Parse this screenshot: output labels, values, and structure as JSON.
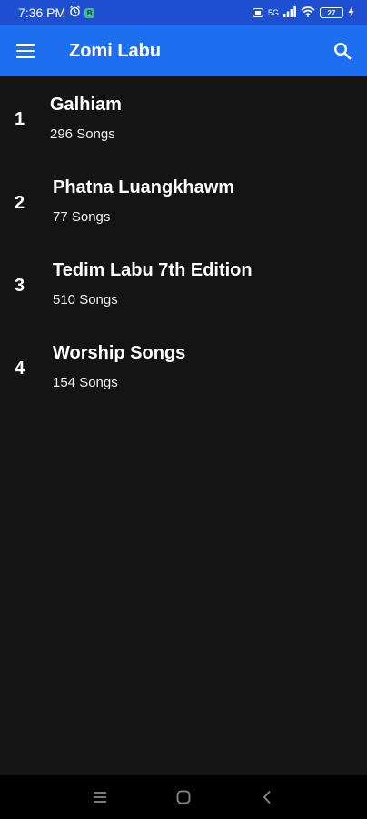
{
  "status_bar": {
    "time": "7:36 PM",
    "signal_label": "5G",
    "battery": "27"
  },
  "app_bar": {
    "title": "Zomi Labu",
    "menu_icon": "hamburger-menu-icon",
    "search_icon": "search-icon"
  },
  "books": [
    {
      "number": "1",
      "title": "Galhiam",
      "count": "296 Songs"
    },
    {
      "number": "2",
      "title": "Phatna Luangkhawm",
      "count": "77 Songs"
    },
    {
      "number": "3",
      "title": "Tedim Labu 7th Edition",
      "count": "510 Songs"
    },
    {
      "number": "4",
      "title": "Worship Songs",
      "count": "154 Songs"
    }
  ],
  "colors": {
    "status_bar": "#1f4fd1",
    "app_bar": "#1e6ff0",
    "background": "#141414",
    "nav_bar": "#000000"
  }
}
